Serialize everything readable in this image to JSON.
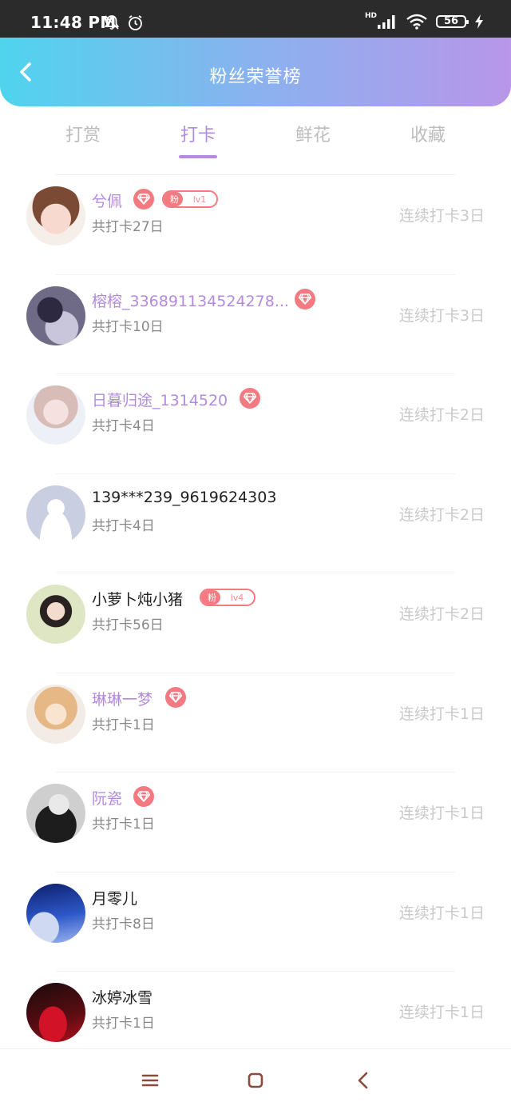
{
  "status_bar": {
    "time": "11:48 PM",
    "network": "HD",
    "battery": "56"
  },
  "header": {
    "title": "粉丝荣誉榜"
  },
  "tabs": [
    {
      "label": "打赏"
    },
    {
      "label": "打卡",
      "active": true
    },
    {
      "label": "鲜花"
    },
    {
      "label": "收藏"
    }
  ],
  "fans": [
    {
      "name": "兮佩",
      "vip": true,
      "diamond": true,
      "fan_badge": {
        "label": "粉",
        "level": "lv1"
      },
      "total": "共打卡27日",
      "streak": "连续打卡3日"
    },
    {
      "name": "榕榕_336891134524278...",
      "vip": true,
      "diamond": true,
      "fan_badge": null,
      "total": "共打卡10日",
      "streak": "连续打卡3日"
    },
    {
      "name": "日暮归途_1314520",
      "vip": true,
      "diamond": true,
      "fan_badge": null,
      "total": "共打卡4日",
      "streak": "连续打卡2日"
    },
    {
      "name": "139***239_9619624303",
      "vip": false,
      "diamond": false,
      "fan_badge": null,
      "total": "共打卡4日",
      "streak": "连续打卡2日"
    },
    {
      "name": "小萝卜炖小猪",
      "vip": false,
      "diamond": false,
      "fan_badge": {
        "label": "粉",
        "level": "lv4"
      },
      "total": "共打卡56日",
      "streak": "连续打卡2日"
    },
    {
      "name": "琳琳一梦",
      "vip": true,
      "diamond": true,
      "fan_badge": null,
      "total": "共打卡1日",
      "streak": "连续打卡1日"
    },
    {
      "name": "阮瓷",
      "vip": true,
      "diamond": true,
      "fan_badge": null,
      "total": "共打卡1日",
      "streak": "连续打卡1日"
    },
    {
      "name": "月零儿",
      "vip": false,
      "diamond": false,
      "fan_badge": null,
      "total": "共打卡8日",
      "streak": "连续打卡1日"
    },
    {
      "name": "冰婷冰雪",
      "vip": false,
      "diamond": false,
      "fan_badge": null,
      "total": "共打卡1日",
      "streak": "连续打卡1日"
    }
  ],
  "colors": {
    "accent": "#b48ae0",
    "badge": "#f47a82",
    "header_start": "#4fd4ee",
    "header_end": "#b896ea"
  },
  "icons": [
    "back-chevron-icon",
    "diamond-icon",
    "menu-icon",
    "home-square-icon",
    "back-triangle-icon"
  ]
}
